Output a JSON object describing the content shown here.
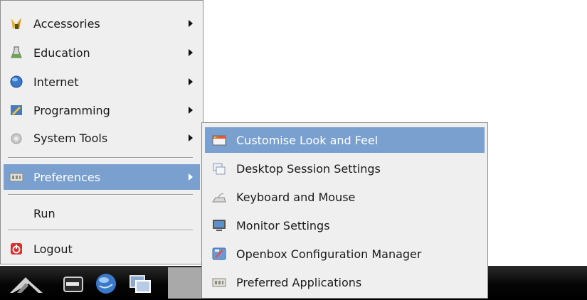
{
  "main_menu": {
    "items": [
      {
        "label": "Accessories",
        "icon": "accessories-icon",
        "submenu": true
      },
      {
        "label": "Education",
        "icon": "education-icon",
        "submenu": true
      },
      {
        "label": "Internet",
        "icon": "internet-icon",
        "submenu": true
      },
      {
        "label": "Programming",
        "icon": "programming-icon",
        "submenu": true
      },
      {
        "label": "System Tools",
        "icon": "system-tools-icon",
        "submenu": true
      },
      {
        "label": "Preferences",
        "icon": "preferences-icon",
        "submenu": true,
        "selected": true
      },
      {
        "label": "Run",
        "icon": "",
        "submenu": false
      },
      {
        "label": "Logout",
        "icon": "logout-icon",
        "submenu": false
      }
    ]
  },
  "sub_menu": {
    "items": [
      {
        "label": "Customise Look and Feel",
        "icon": "look-and-feel-icon",
        "selected": true
      },
      {
        "label": "Desktop Session Settings",
        "icon": "desktop-session-icon"
      },
      {
        "label": "Keyboard and Mouse",
        "icon": "keyboard-icon"
      },
      {
        "label": "Monitor Settings",
        "icon": "monitor-icon"
      },
      {
        "label": "Openbox Configuration Manager",
        "icon": "openbox-config-icon"
      },
      {
        "label": "Preferred Applications",
        "icon": "preferred-applications-icon"
      }
    ]
  },
  "taskbar": {
    "icons": [
      "start-menu-icon",
      "terminal-icon",
      "browser-globe-icon",
      "desktop-windows-icon"
    ]
  },
  "colors": {
    "selection": "#7aa0cf",
    "menu_background": "#efefef",
    "taskbar": "#000000"
  }
}
